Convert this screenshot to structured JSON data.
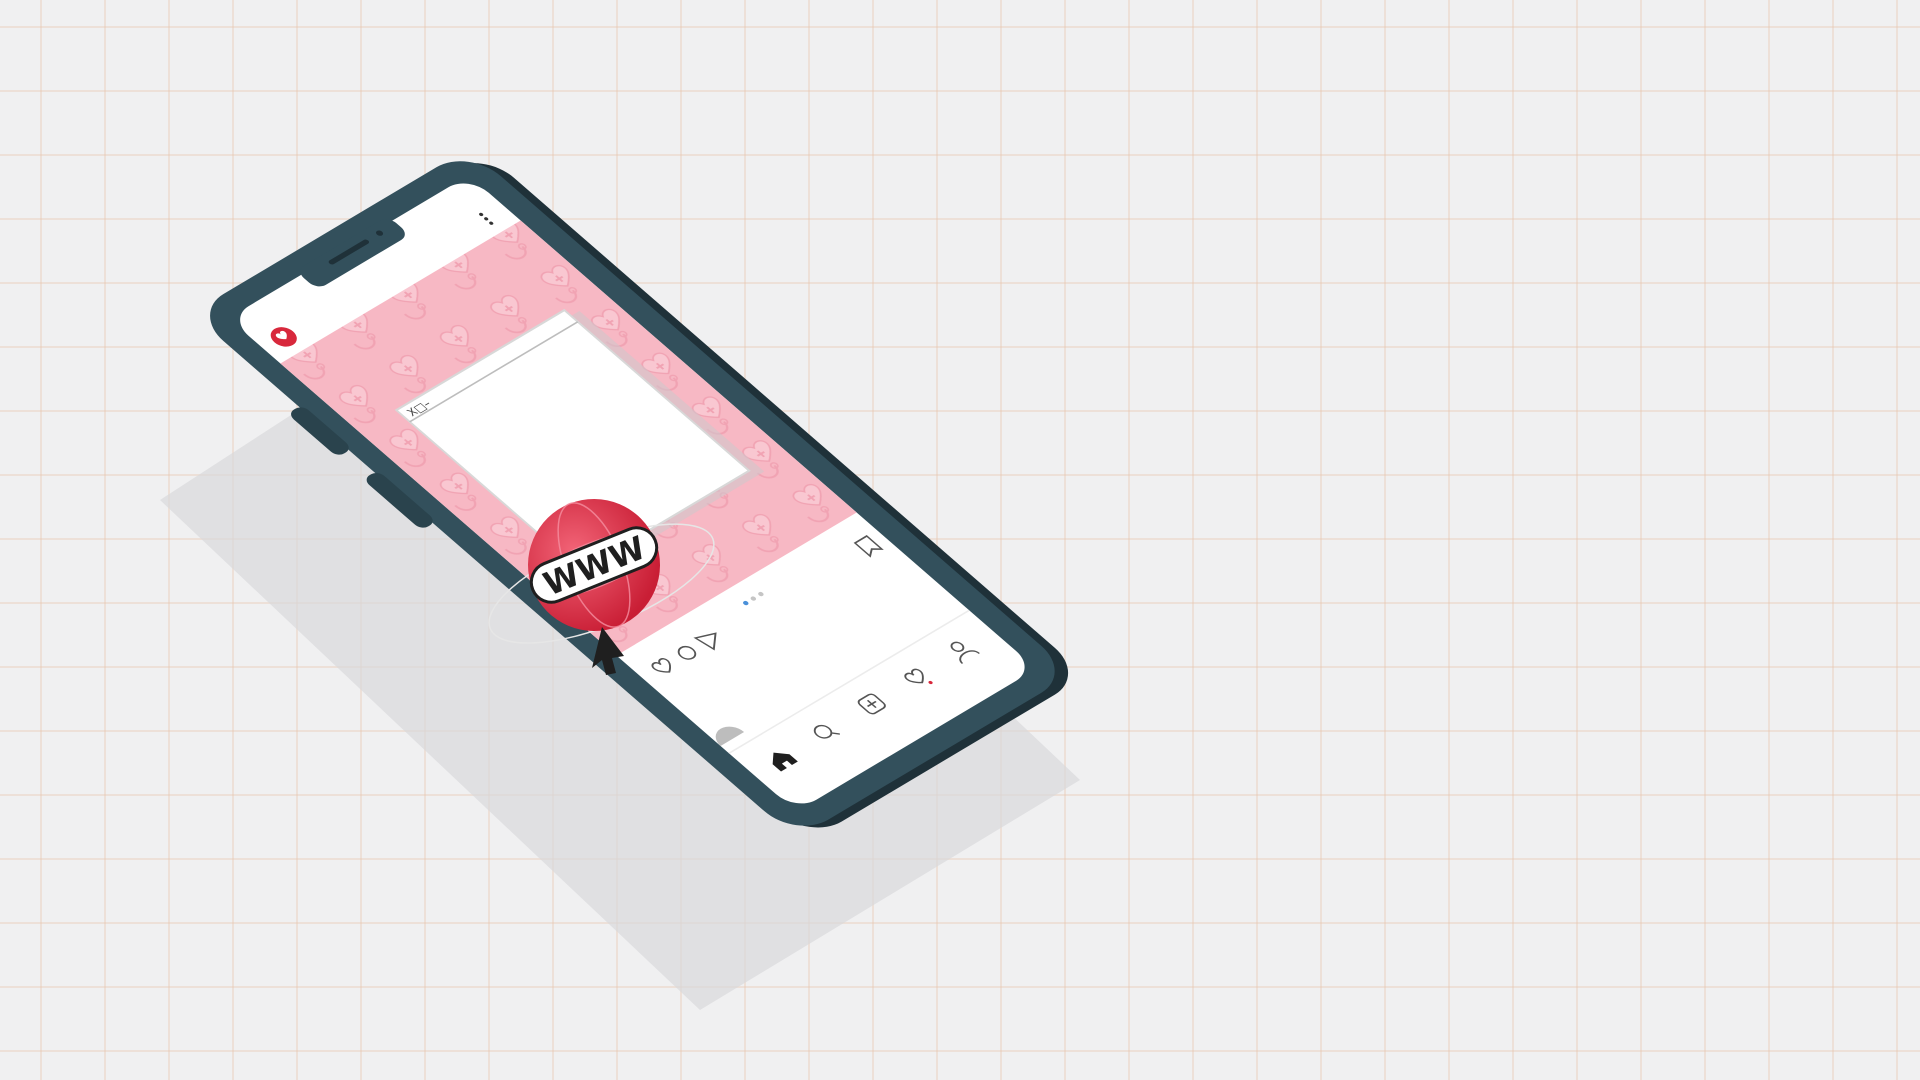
{
  "scene": "isometric-smartphone-social-post",
  "post": {
    "avatar_icon": "heart-stethoscope-icon",
    "menu_icon": "more-dots-icon",
    "browser_window": {
      "controls": "X□–",
      "globe_label": "WWW",
      "cursor_icon": "arrow-cursor-icon"
    },
    "carousel_dots": 3,
    "active_dot": 1,
    "actions": [
      "heart-icon",
      "comment-icon",
      "share-icon",
      "bookmark-icon"
    ]
  },
  "navbar": {
    "items": [
      "home-icon",
      "search-icon",
      "add-icon",
      "activity-heart-icon",
      "profile-icon"
    ]
  },
  "colors": {
    "background": "#f0f0f1",
    "grid": "#ead2c2",
    "phone_body": "#2f4a55",
    "phone_dark": "#1e2f36",
    "post_pink": "#f7b7c3",
    "accent_red": "#d8283c",
    "dot_active": "#4a90d9"
  }
}
